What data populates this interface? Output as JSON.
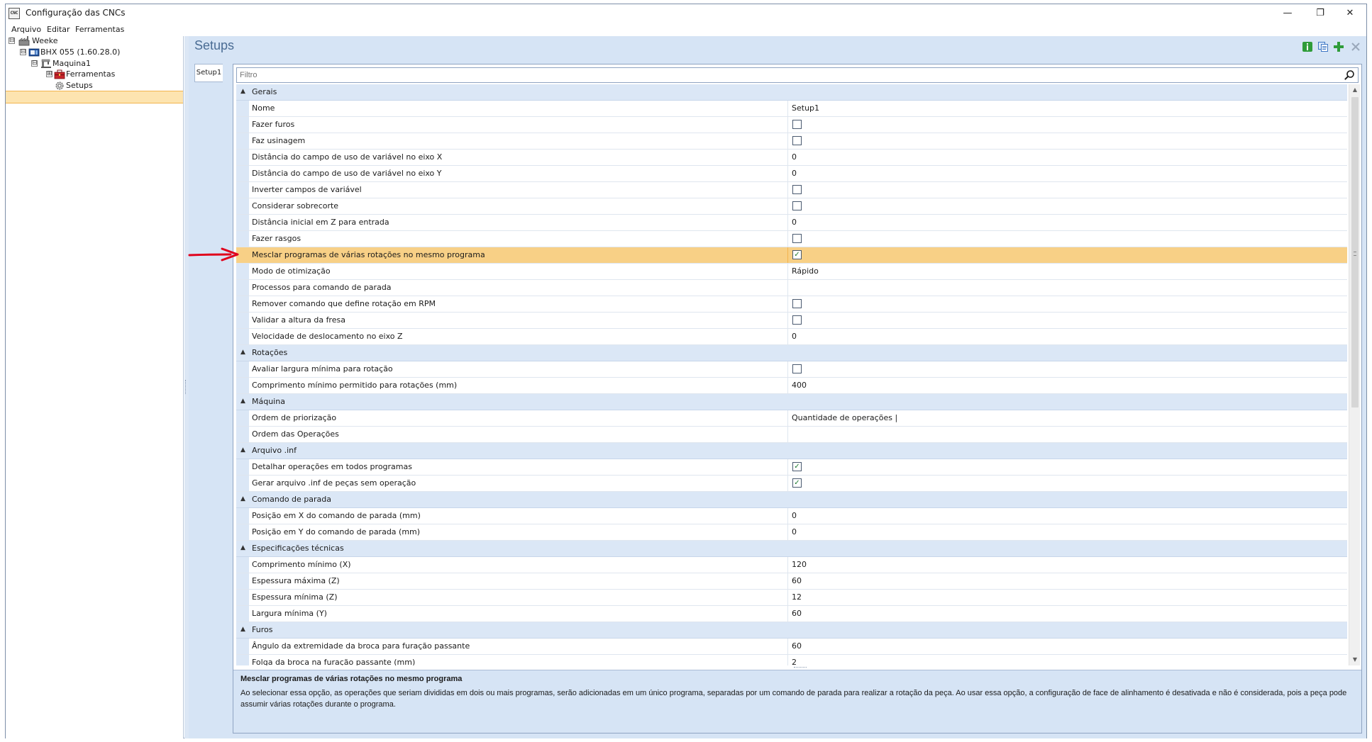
{
  "window": {
    "title": "Configuração das CNCs",
    "app_icon_text": "CNC",
    "controls": {
      "minimize": "—",
      "maximize": "❐",
      "close": "✕"
    }
  },
  "menu": [
    "Arquivo",
    "Editar",
    "Ferramentas"
  ],
  "tree": {
    "nodes": [
      {
        "label": "Weeke",
        "expander": "⊟",
        "icon": "factory-icon"
      },
      {
        "label": "BHX 055 (1.60.28.0)",
        "expander": "⊟",
        "icon": "cnc-machine-icon"
      },
      {
        "label": "Maquina1",
        "expander": "⊟",
        "icon": "machine-icon"
      },
      {
        "label": "Ferramentas",
        "expander": "⊞",
        "icon": "toolbox-icon"
      },
      {
        "label": "Setups",
        "expander": "",
        "icon": "gear-icon"
      }
    ],
    "selected": "Setups"
  },
  "main": {
    "title": "Setups",
    "toolbar": [
      "info-icon",
      "copy-icon",
      "add-icon",
      "close-icon"
    ],
    "tab": "Setup1",
    "filter_placeholder": "Filtro"
  },
  "grid": {
    "rows": [
      {
        "type": "cat",
        "name": "Gerais"
      },
      {
        "type": "prop",
        "name": "Nome",
        "value": "Setup1"
      },
      {
        "type": "check",
        "name": "Fazer furos",
        "checked": false
      },
      {
        "type": "check",
        "name": "Faz usinagem",
        "checked": false
      },
      {
        "type": "prop",
        "name": "Distância do campo de uso de variável no eixo X",
        "value": "0"
      },
      {
        "type": "prop",
        "name": "Distância do campo de uso de variável no eixo Y",
        "value": "0"
      },
      {
        "type": "check",
        "name": "Inverter campos de variável",
        "checked": false
      },
      {
        "type": "check",
        "name": "Considerar sobrecorte",
        "checked": false
      },
      {
        "type": "prop",
        "name": "Distância inicial em Z para entrada",
        "value": "0"
      },
      {
        "type": "check",
        "name": "Fazer rasgos",
        "checked": false
      },
      {
        "type": "check",
        "name": "Mesclar programas de várias rotações no mesmo programa",
        "checked": true,
        "highlight": true
      },
      {
        "type": "prop",
        "name": "Modo de otimização",
        "value": "Rápido"
      },
      {
        "type": "prop",
        "name": "Processos para comando de parada",
        "value": ""
      },
      {
        "type": "check",
        "name": "Remover comando que define rotação em RPM",
        "checked": false
      },
      {
        "type": "check",
        "name": "Validar a altura da fresa",
        "checked": false
      },
      {
        "type": "prop",
        "name": "Velocidade de deslocamento no eixo Z",
        "value": "0"
      },
      {
        "type": "cat",
        "name": "Rotações"
      },
      {
        "type": "check",
        "name": "Avaliar largura mínima para rotação",
        "checked": false
      },
      {
        "type": "prop",
        "name": "Comprimento mínimo permitido para rotações (mm)",
        "value": "400"
      },
      {
        "type": "cat",
        "name": "Máquina"
      },
      {
        "type": "prop",
        "name": "Ordem de priorização",
        "value": "Quantidade de operações |"
      },
      {
        "type": "prop",
        "name": "Ordem das Operações",
        "value": ""
      },
      {
        "type": "cat",
        "name": "Arquivo .inf"
      },
      {
        "type": "check",
        "name": "Detalhar operações em todos programas",
        "checked": true
      },
      {
        "type": "check",
        "name": "Gerar arquivo .inf de peças sem operação",
        "checked": true
      },
      {
        "type": "cat",
        "name": "Comando de parada"
      },
      {
        "type": "prop",
        "name": "Posição em X do comando de parada (mm)",
        "value": "0"
      },
      {
        "type": "prop",
        "name": "Posição em Y do comando de parada (mm)",
        "value": "0"
      },
      {
        "type": "cat",
        "name": "Especificações técnicas"
      },
      {
        "type": "prop",
        "name": "Comprimento mínimo (X)",
        "value": "120"
      },
      {
        "type": "prop",
        "name": "Espessura máxima (Z)",
        "value": "60"
      },
      {
        "type": "prop",
        "name": "Espessura mínima (Z)",
        "value": "12"
      },
      {
        "type": "prop",
        "name": "Largura mínima (Y)",
        "value": "60"
      },
      {
        "type": "cat",
        "name": "Furos"
      },
      {
        "type": "prop",
        "name": "Ângulo da extremidade da broca para furação passante",
        "value": "60"
      },
      {
        "type": "prop",
        "name": "Folga da broca na furação passante (mm)",
        "value": "2"
      }
    ]
  },
  "description": {
    "title": "Mesclar programas de várias rotações no mesmo programa",
    "body": "Ao selecionar essa opção, as operações que seriam divididas em dois ou mais programas, serão adicionadas em um único programa, separadas por um comando de parada para realizar a rotação da peça. Ao usar essa opção, a configuração de face de alinhamento é desativada e não é considerada, pois a peça pode assumir várias rotações durante o programa."
  },
  "colors": {
    "highlight_row": "#f8d086",
    "category_row": "#dbe7f6",
    "panel_bg": "#d6e4f5",
    "title_blue": "#4a6c94",
    "annotation_arrow": "#e0001b"
  }
}
